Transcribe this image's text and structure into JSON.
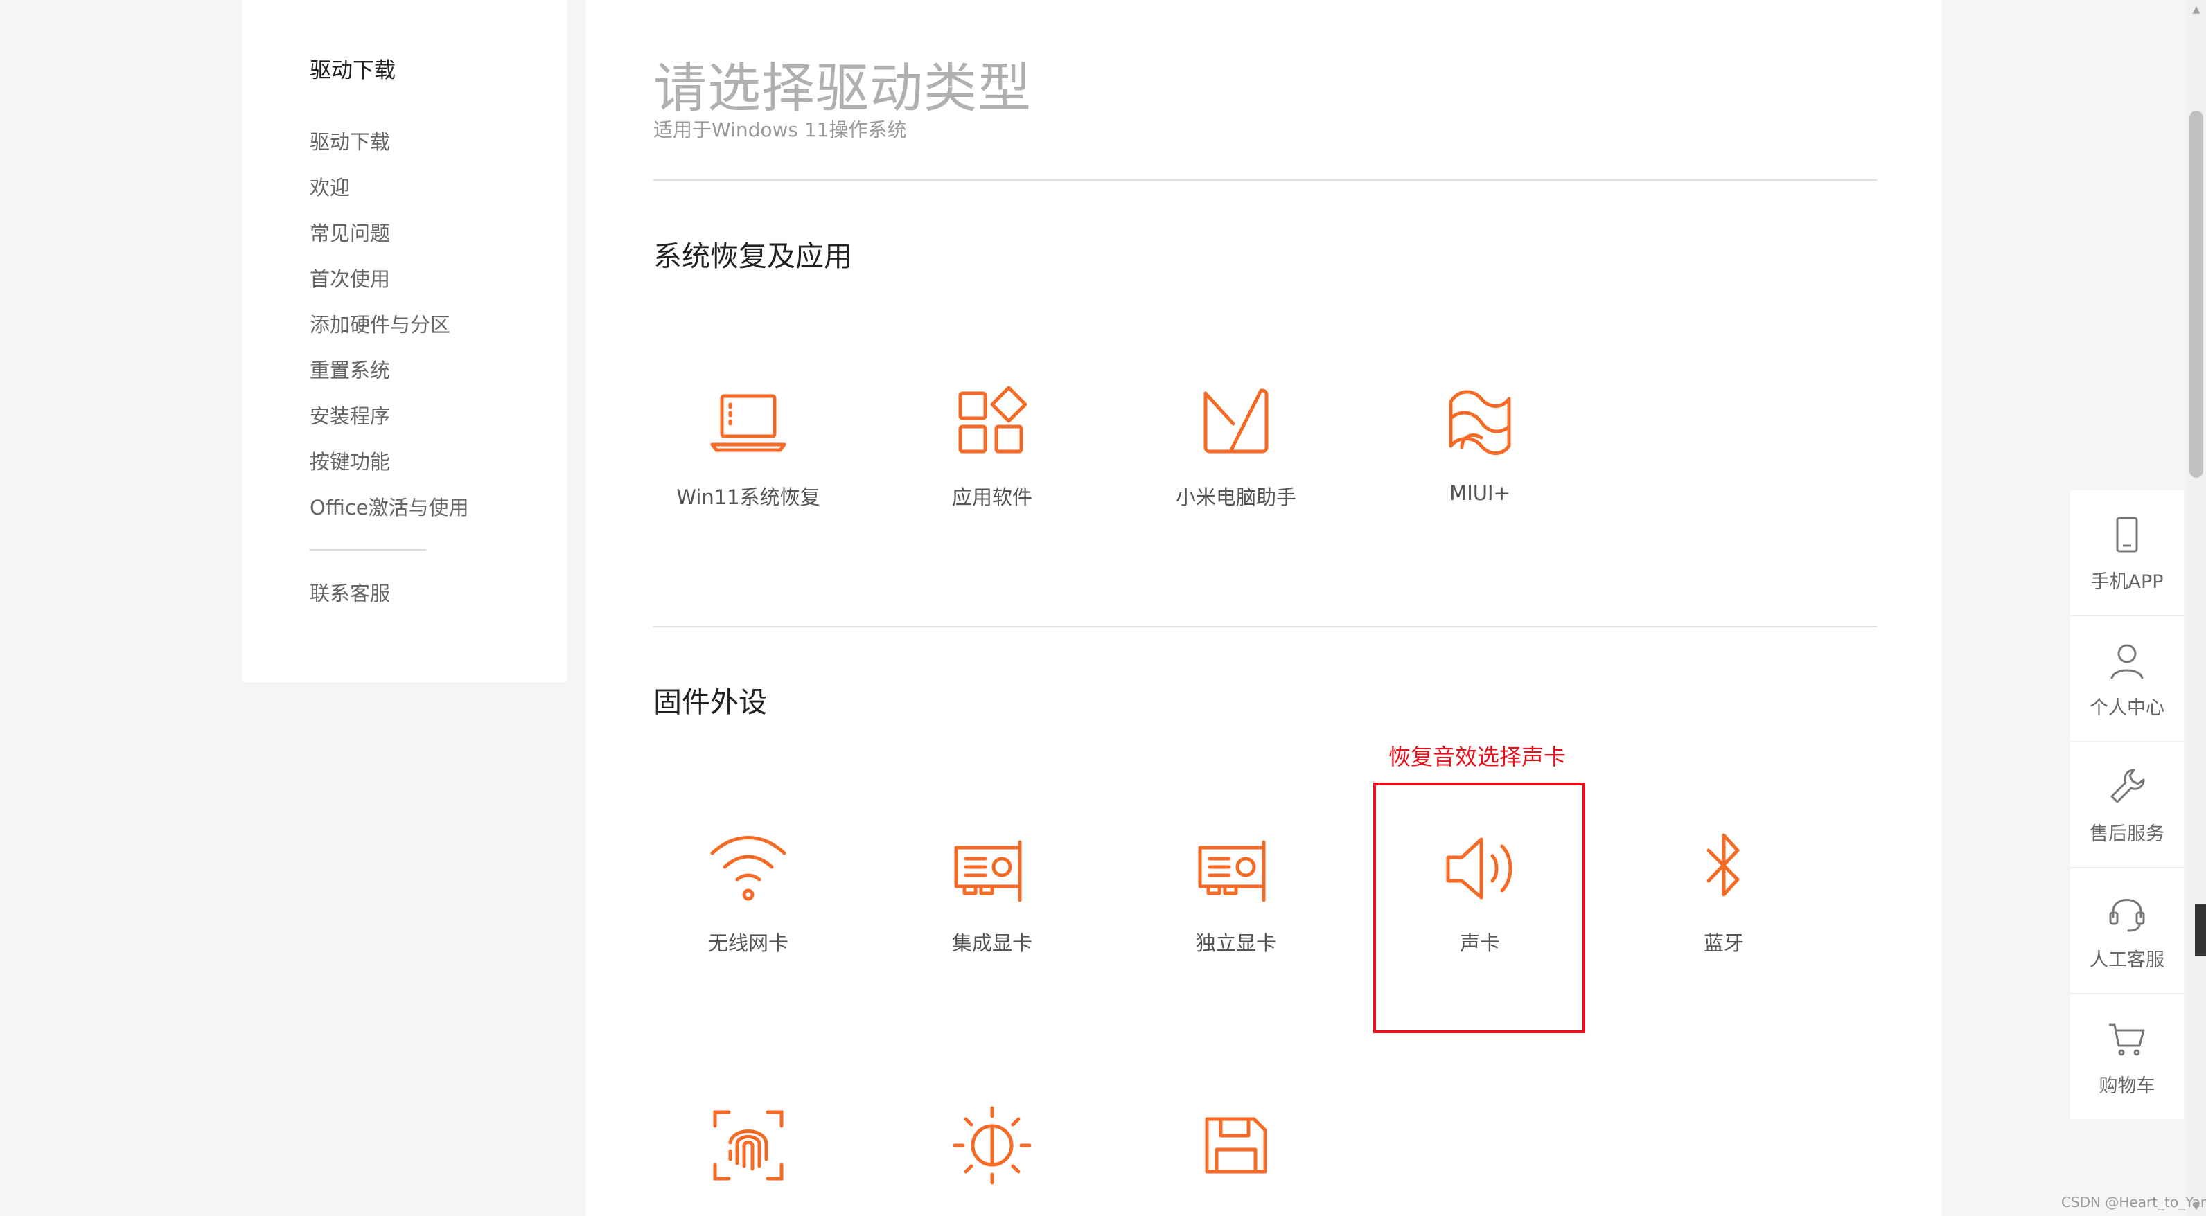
{
  "sidebar": {
    "title": "驱动下载",
    "items": [
      {
        "label": "驱动下载"
      },
      {
        "label": "欢迎"
      },
      {
        "label": "常见问题"
      },
      {
        "label": "首次使用"
      },
      {
        "label": "添加硬件与分区"
      },
      {
        "label": "重置系统"
      },
      {
        "label": "安装程序"
      },
      {
        "label": "按键功能"
      },
      {
        "label": "Office激活与使用"
      }
    ],
    "contact": "联系客服"
  },
  "main": {
    "title": "请选择驱动类型",
    "subtitle": "适用于Windows 11操作系统",
    "sections": [
      {
        "title": "系统恢复及应用",
        "items": [
          {
            "label": "Win11系统恢复",
            "icon": "laptop-icon"
          },
          {
            "label": "应用软件",
            "icon": "apps-icon"
          },
          {
            "label": "小米电脑助手",
            "icon": "mi-assistant-icon"
          },
          {
            "label": "MIUI+",
            "icon": "miui-plus-icon"
          }
        ]
      },
      {
        "title": "固件外设",
        "items": [
          {
            "label": "无线网卡",
            "icon": "wifi-icon"
          },
          {
            "label": "集成显卡",
            "icon": "graphics-card-icon"
          },
          {
            "label": "独立显卡",
            "icon": "graphics-card-icon"
          },
          {
            "label": "声卡",
            "icon": "speaker-icon"
          },
          {
            "label": "蓝牙",
            "icon": "bluetooth-icon"
          }
        ],
        "more_icons": [
          "fingerprint-icon",
          "brightness-icon",
          "floppy-disk-icon"
        ]
      }
    ]
  },
  "annotation": {
    "text": "恢复音效选择声卡",
    "color": "#e8101a"
  },
  "right_toolbar": [
    {
      "label": "手机APP",
      "icon": "phone-icon"
    },
    {
      "label": "个人中心",
      "icon": "user-icon"
    },
    {
      "label": "售后服务",
      "icon": "wrench-icon"
    },
    {
      "label": "人工客服",
      "icon": "headset-icon"
    },
    {
      "label": "购物车",
      "icon": "cart-icon"
    }
  ],
  "watermark": "CSDN @Heart_to_Yang",
  "colors": {
    "accent": "#f56a24",
    "annotation": "#e8101a"
  }
}
